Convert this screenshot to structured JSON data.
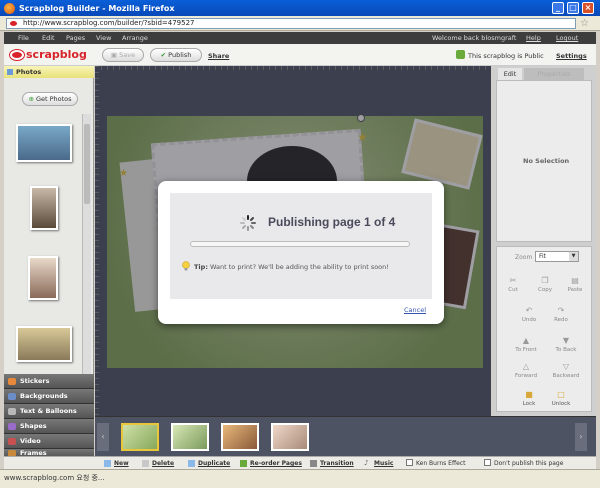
{
  "window": {
    "title": "Scrapblog Builder - Mozilla Firefox",
    "url": "http://www.scrapblog.com/builder/?sbid=479527"
  },
  "menu": {
    "items": [
      "File",
      "Edit",
      "Pages",
      "View",
      "Arrange"
    ],
    "welcome": "Welcome back blosmgraft",
    "help": "Help",
    "logout": "Logout"
  },
  "toolbar": {
    "logo": "scrapblog",
    "save": "Save",
    "publish": "Publish",
    "share": "Share",
    "public_status": "This scrapblog is Public",
    "settings": "Settings"
  },
  "sidebar": {
    "header": "Photos",
    "get_photos": "Get Photos",
    "categories": [
      {
        "label": "Stickers",
        "color": "#e8883a"
      },
      {
        "label": "Backgrounds",
        "color": "#6b8ec8"
      },
      {
        "label": "Text & Balloons",
        "color": "#b8b8b8"
      },
      {
        "label": "Shapes",
        "color": "#9a6bc8"
      },
      {
        "label": "Video",
        "color": "#c85050"
      },
      {
        "label": "Frames",
        "color": "#c88a3a"
      }
    ]
  },
  "right_panel": {
    "tab_edit": "Edit",
    "tab_other": "Properties",
    "no_selection": "No Selection",
    "zoom_label": "Zoom",
    "zoom_value": "Fit",
    "buttons": [
      "Cut",
      "Copy",
      "Paste",
      "Undo",
      "Redo",
      "To Front",
      "To Back",
      "Forward",
      "Backward",
      "Lock",
      "Unlock"
    ]
  },
  "modal": {
    "title": "Publishing page 1 of 4",
    "progress": 0,
    "tip_label": "Tip:",
    "tip_text": "Want to print? We'll be adding the ability to print soon!",
    "cancel": "Cancel"
  },
  "bottombar": {
    "new": "New",
    "delete": "Delete",
    "duplicate": "Duplicate",
    "reorder": "Re-order Pages",
    "transition": "Transition",
    "music": "Music",
    "ken_burns": "Ken Burns Effect",
    "dont_publish": "Don't publish this page"
  },
  "status": "www.scrapblog.com 요청 중..."
}
